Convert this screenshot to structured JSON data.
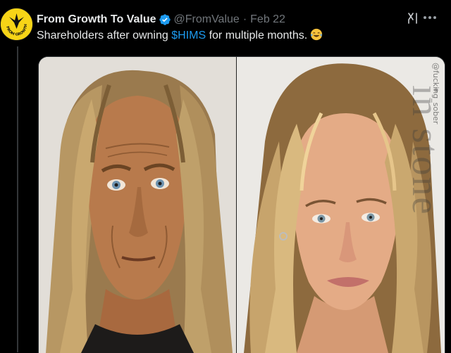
{
  "tweet": {
    "display_name": "From Growth To Value",
    "handle": "@FromValue",
    "separator": "·",
    "date": "Feb 22",
    "text_before": "Shareholders after owning ",
    "cashtag": "$HIMS",
    "text_after": " for multiple months.",
    "emoji": "face-with-tears-of-joy"
  },
  "avatar": {
    "logo_text": "FROM GROWTH TO VALUE"
  },
  "actions": {
    "grok_icon": "grok-icon",
    "more_icon": "more-options-icon"
  },
  "media": {
    "left_image": "photo-aged-man-long-hair",
    "right_image": "photo-woman-long-blonde-hair",
    "watermark": "@fucking_sober",
    "background_text": "in stone"
  },
  "colors": {
    "background": "#000000",
    "text_primary": "#e7e9ea",
    "text_secondary": "#71767b",
    "accent": "#1d9bf0",
    "avatar_bg": "#f7d417"
  }
}
